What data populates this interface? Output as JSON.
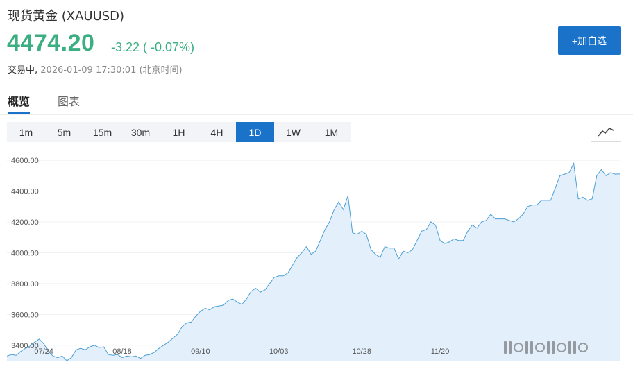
{
  "header": {
    "title": "现货黄金 (XAUUSD)",
    "price": "4474.20",
    "change": "-3.22 ( -0.07%)",
    "status_label": "交易中,",
    "timestamp": "2026-01-09 17:30:01 (北京时间)",
    "add_button": "+加自选",
    "accent_color": "#3bae82",
    "button_color": "#1a73c9"
  },
  "tabs": [
    {
      "label": "概览",
      "active": true
    },
    {
      "label": "图表",
      "active": false
    }
  ],
  "periods": [
    {
      "label": "1m",
      "active": false
    },
    {
      "label": "5m",
      "active": false
    },
    {
      "label": "15m",
      "active": false
    },
    {
      "label": "30m",
      "active": false
    },
    {
      "label": "1H",
      "active": false
    },
    {
      "label": "4H",
      "active": false
    },
    {
      "label": "1D",
      "active": true
    },
    {
      "label": "1W",
      "active": false
    },
    {
      "label": "1M",
      "active": false
    }
  ],
  "chart_type_icon": "line-chart-icon",
  "chart_data": {
    "type": "area",
    "title": "",
    "xlabel": "",
    "ylabel": "",
    "ylim": [
      3300,
      4650
    ],
    "yticks": [
      "3400.00",
      "3600.00",
      "3800.00",
      "4000.00",
      "4200.00",
      "4400.00",
      "4600.00"
    ],
    "xticks": [
      {
        "label": "07/24",
        "index": 8
      },
      {
        "label": "08/18",
        "index": 25
      },
      {
        "label": "09/10",
        "index": 42
      },
      {
        "label": "10/03",
        "index": 59
      },
      {
        "label": "10/28",
        "index": 77
      },
      {
        "label": "11/20",
        "index": 94
      }
    ],
    "line_color": "#4a9fd5",
    "fill_color": "#e3f0fb",
    "values": [
      3330,
      3340,
      3335,
      3360,
      3380,
      3395,
      3420,
      3440,
      3410,
      3360,
      3330,
      3320,
      3330,
      3300,
      3320,
      3370,
      3380,
      3370,
      3390,
      3400,
      3385,
      3390,
      3340,
      3335,
      3340,
      3320,
      3330,
      3325,
      3330,
      3315,
      3335,
      3340,
      3355,
      3380,
      3400,
      3420,
      3445,
      3470,
      3520,
      3545,
      3550,
      3590,
      3620,
      3640,
      3630,
      3650,
      3655,
      3660,
      3690,
      3700,
      3680,
      3665,
      3700,
      3750,
      3770,
      3745,
      3760,
      3800,
      3840,
      3850,
      3850,
      3870,
      3920,
      3970,
      4000,
      4040,
      3990,
      4010,
      4080,
      4150,
      4200,
      4280,
      4330,
      4280,
      4370,
      4130,
      4120,
      4140,
      4120,
      4020,
      3990,
      3970,
      4040,
      4030,
      4030,
      3960,
      4010,
      4000,
      4020,
      4080,
      4140,
      4150,
      4200,
      4180,
      4080,
      4060,
      4070,
      4090,
      4080,
      4080,
      4140,
      4180,
      4160,
      4200,
      4210,
      4250,
      4220,
      4220,
      4220,
      4210,
      4200,
      4220,
      4250,
      4300,
      4310,
      4310,
      4340,
      4340,
      4340,
      4420,
      4500,
      4510,
      4520,
      4580,
      4350,
      4360,
      4340,
      4350,
      4500,
      4540,
      4500,
      4520,
      4510,
      4512
    ]
  }
}
